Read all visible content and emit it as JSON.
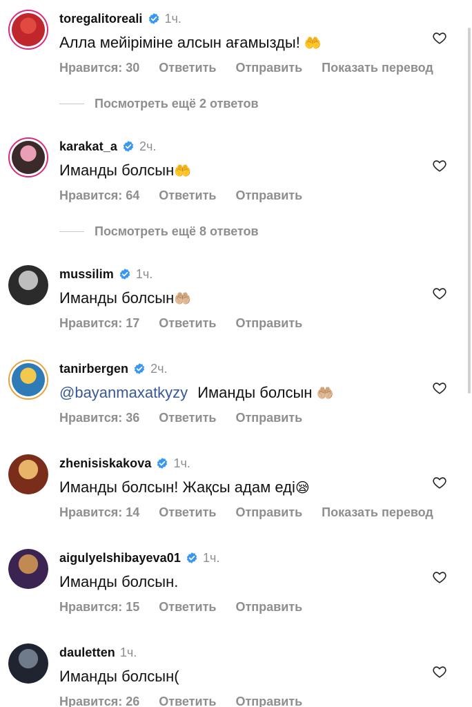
{
  "labels": {
    "like": "Нравится: ",
    "reply": "Ответить",
    "send": "Отправить",
    "translate": "Показать перевод"
  },
  "comments": [
    {
      "username": "toregalitoreali",
      "verified": true,
      "time": "1ч.",
      "mention": "",
      "text": "Алла мейіріміне алсын ағамызды! ",
      "emoji": "🤲",
      "likes": "30",
      "show_translate": true,
      "avatar_colors": [
        "#c0272d",
        "#e04a3f"
      ],
      "ring": "story"
    },
    {
      "username": "karakat_a",
      "verified": true,
      "time": "2ч.",
      "mention": "",
      "text": "Иманды болсын",
      "emoji": "🤲",
      "likes": "64",
      "show_translate": false,
      "avatar_colors": [
        "#3a2a2a",
        "#e9a0b6"
      ],
      "ring": "story"
    },
    {
      "username": "mussilim",
      "verified": true,
      "time": "1ч.",
      "mention": "",
      "text": "Иманды болсын",
      "emoji": "🤲🏼",
      "likes": "17",
      "show_translate": false,
      "avatar_colors": [
        "#2b2b2b",
        "#bdbdbd"
      ],
      "ring": "none"
    },
    {
      "username": "tanirbergen",
      "verified": true,
      "time": "2ч.",
      "mention": "@bayanmaxatkyzy",
      "text": "Иманды болсын ",
      "emoji": "🤲🏼",
      "likes": "36",
      "show_translate": false,
      "avatar_colors": [
        "#2e7bb8",
        "#f2c94c"
      ],
      "ring": "gold"
    },
    {
      "username": "zhenisiskakova",
      "verified": true,
      "time": "1ч.",
      "mention": "",
      "text": "Иманды болсын! Жақсы адам еді",
      "emoji": "😪",
      "likes": "14",
      "show_translate": true,
      "avatar_colors": [
        "#7a2d1a",
        "#e7b46a"
      ],
      "ring": "none"
    },
    {
      "username": "aigulyelshibayeva01",
      "verified": true,
      "time": "1ч.",
      "mention": "",
      "text": "Иманды болсын.",
      "emoji": "",
      "likes": "15",
      "show_translate": false,
      "avatar_colors": [
        "#3b2452",
        "#c08a52"
      ],
      "ring": "none"
    },
    {
      "username": "dauletten",
      "verified": false,
      "time": "1ч.",
      "mention": "",
      "text": "Иманды болсын(",
      "emoji": "",
      "likes": "26",
      "show_translate": false,
      "avatar_colors": [
        "#1f2430",
        "#6f7a8a"
      ],
      "ring": "none"
    }
  ],
  "more_replies": [
    {
      "after_comment": 0,
      "label": "Посмотреть ещё 2 ответов"
    },
    {
      "after_comment": 1,
      "label": "Посмотреть ещё 8 ответов"
    }
  ],
  "colors": {
    "verified": "#3897f0",
    "secondary_text": "#8e8e8e",
    "mention": "#385898"
  }
}
